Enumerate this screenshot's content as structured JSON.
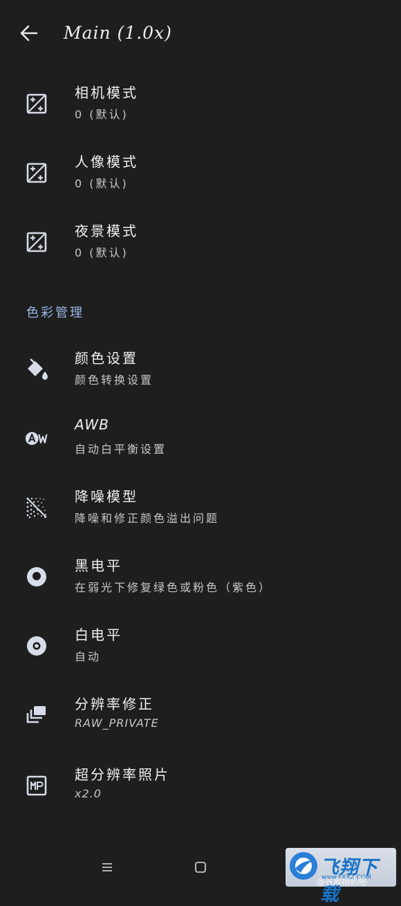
{
  "header": {
    "title": "Main (1.0x)"
  },
  "exposure_items": [
    {
      "title": "相机模式",
      "subtitle": "0 (默认)",
      "icon": "exposure-plus-minus-icon"
    },
    {
      "title": "人像模式",
      "subtitle": "0 (默认)",
      "icon": "exposure-plus-minus-icon"
    },
    {
      "title": "夜景模式",
      "subtitle": "0 (默认)",
      "icon": "exposure-plus-minus-icon"
    }
  ],
  "section": {
    "title": "色彩管理"
  },
  "color_items": [
    {
      "title": "颜色设置",
      "subtitle": "颜色转换设置",
      "icon": "paint-bucket-icon"
    },
    {
      "title": "AWB",
      "subtitle": "自动白平衡设置",
      "icon": "awb-icon"
    },
    {
      "title": "降噪模型",
      "subtitle": "降噪和修正颜色溢出问题",
      "icon": "grain-noise-icon"
    },
    {
      "title": "黑电平",
      "subtitle": "在弱光下修复绿色或粉色（紫色）",
      "icon": "black-level-icon"
    },
    {
      "title": "白电平",
      "subtitle": "自动",
      "icon": "white-level-icon"
    },
    {
      "title": "分辨率修正",
      "subtitle": "RAW_PRIVATE",
      "icon": "layers-icon"
    },
    {
      "title": "超分辨率照片",
      "subtitle": "x2.0",
      "icon": "megapixel-icon"
    }
  ],
  "watermark": {
    "brand": "飞翔下载",
    "url": "www.FXXZ.COM",
    "caption": "@谷歌相机吧"
  },
  "colors": {
    "background": "#1e1e1e",
    "accent": "#9ab8e8",
    "icon": "#d6dce8"
  }
}
